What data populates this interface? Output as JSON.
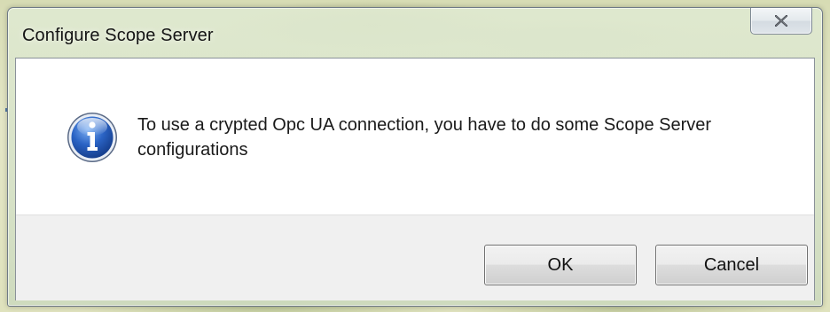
{
  "window": {
    "title": "Configure Scope Server",
    "close_icon": "close-icon"
  },
  "message": {
    "icon": "info-icon",
    "text": "To use a crypted Opc UA connection, you have to do some Scope Server configurations"
  },
  "buttons": {
    "ok_label": "OK",
    "cancel_label": "Cancel"
  },
  "colors": {
    "dialog_background": "#ffffff",
    "footer_background": "#f0f0f0",
    "info_icon_blue": "#2a63c4"
  }
}
